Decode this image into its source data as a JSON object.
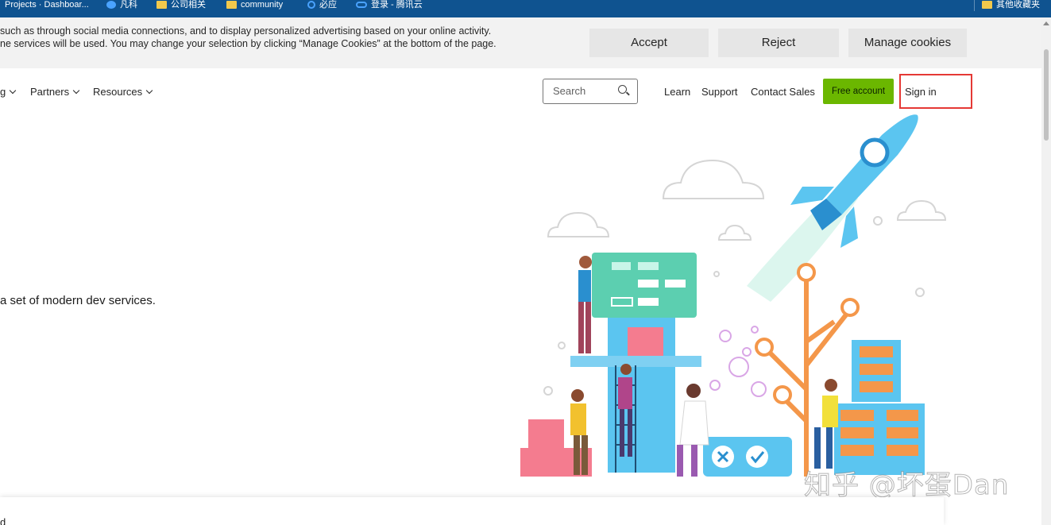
{
  "bookmarks": {
    "items": [
      {
        "label": "Projects · Dashboar...",
        "icon": "page-icon"
      },
      {
        "label": "凡科",
        "icon": "site-icon"
      },
      {
        "label": "公司相关",
        "icon": "folder-icon"
      },
      {
        "label": "community",
        "icon": "folder-icon"
      },
      {
        "label": "必应",
        "icon": "search-icon"
      },
      {
        "label": "登录 - 腾讯云",
        "icon": "cloud-icon"
      }
    ],
    "other": "其他收藏夹"
  },
  "cookie": {
    "line1": "such as through social media connections, and to display personalized advertising based on your online activity.",
    "line2": "ne services will be used. You may change your selection by clicking “Manage Cookies” at the bottom of the page.",
    "accept": "Accept",
    "reject": "Reject",
    "manage": "Manage cookies"
  },
  "nav": {
    "partial": "g",
    "partners": "Partners",
    "resources": "Resources",
    "search_placeholder": "Search",
    "learn": "Learn",
    "support": "Support",
    "contact": "Contact Sales",
    "free": "Free account",
    "signin": "Sign in"
  },
  "hero": {
    "text": "a set of modern dev services."
  },
  "bottom": {
    "text": "d"
  },
  "watermark": "知乎 @坏蛋Dan",
  "colors": {
    "bookmark_bar": "#0f5390",
    "accent_green": "#6bb700",
    "highlight_red": "#e53935"
  }
}
